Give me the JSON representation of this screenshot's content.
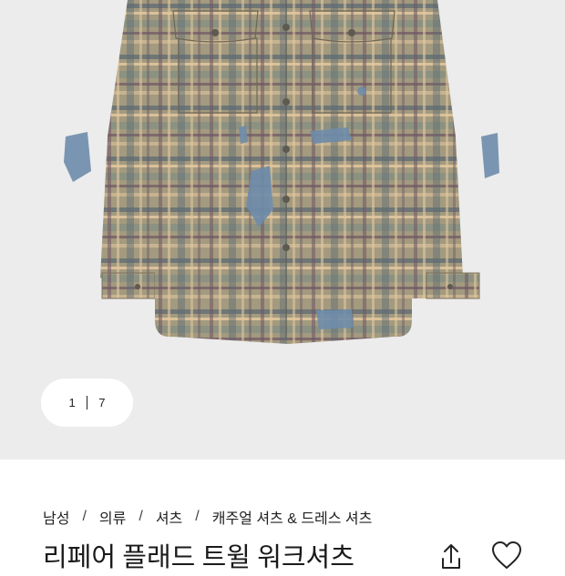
{
  "gallery": {
    "current_page": "1",
    "total_pages": "7",
    "colors": {
      "background": "#ececec",
      "shirt_base": "#a39a7f",
      "plaid_slate": "#5d6a73",
      "plaid_tan": "#e4c89f",
      "plaid_plum": "#6e5664",
      "patch_denim": "#6e8cab"
    }
  },
  "breadcrumb": {
    "items": [
      "남성",
      "의류",
      "셔츠",
      "캐주얼 셔츠 & 드레스 셔츠"
    ],
    "separator": "/"
  },
  "product": {
    "title": "리페어 플래드 트윌 워크셔츠"
  },
  "actions": {
    "share_icon": "share-icon",
    "wishlist_icon": "heart-icon"
  }
}
